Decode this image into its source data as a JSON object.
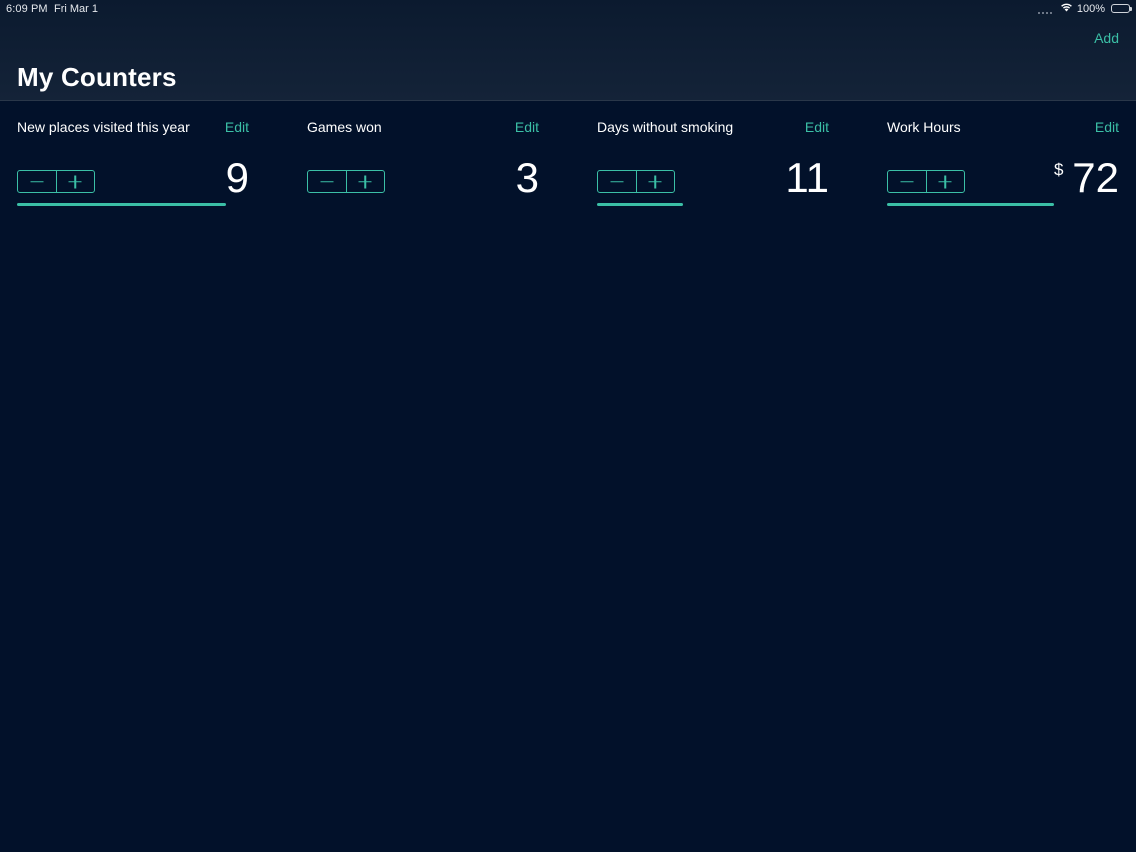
{
  "status_bar": {
    "time": "6:09 PM",
    "date": "Fri Mar 1",
    "battery": "100%"
  },
  "nav": {
    "add_label": "Add",
    "title": "My Counters"
  },
  "counters": [
    {
      "title": "New places visited this year",
      "edit_label": "Edit",
      "value": "9",
      "currency": "",
      "progress": 0.9
    },
    {
      "title": "Games won",
      "edit_label": "Edit",
      "value": "3",
      "currency": "",
      "progress": 0
    },
    {
      "title": "Days without smoking",
      "edit_label": "Edit",
      "value": "11",
      "currency": "",
      "progress": 0.37
    },
    {
      "title": "Work Hours",
      "edit_label": "Edit",
      "value": "72",
      "currency": "$",
      "progress": 0.72
    }
  ],
  "colors": {
    "accent": "#3bbfa6",
    "background": "#02112a",
    "header": "#142338"
  }
}
